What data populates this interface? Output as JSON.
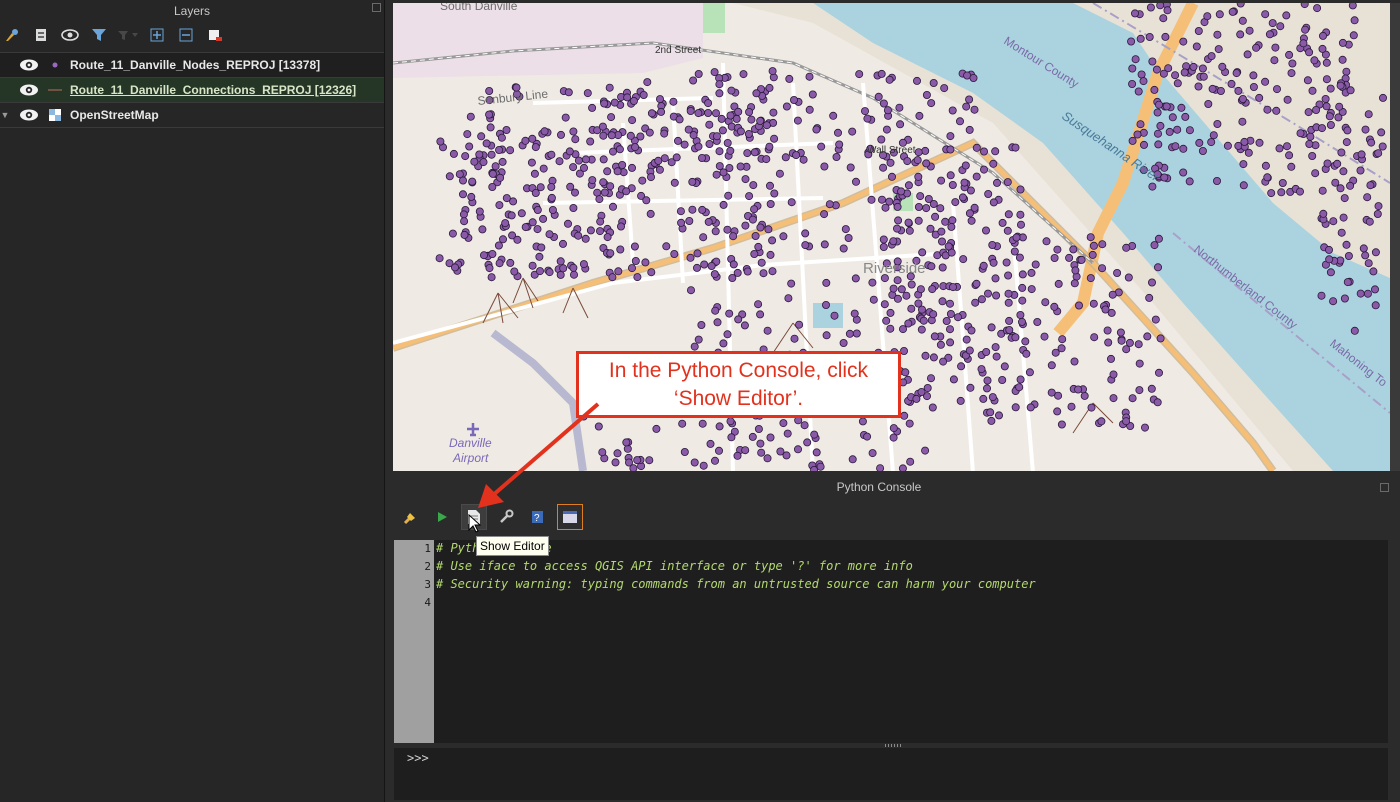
{
  "layers_panel": {
    "title": "Layers",
    "layers": [
      {
        "name": "Route_11_Danville_Nodes_REPROJ [13378]",
        "type": "point"
      },
      {
        "name": "Route_11_Danville_Connections_REPROJ [12326]",
        "type": "line"
      },
      {
        "name": "OpenStreetMap",
        "type": "raster"
      }
    ]
  },
  "map": {
    "labels": {
      "south_danville": "South Danville",
      "second_street": "2nd Street",
      "sunbury_line": "Sunbury Line",
      "montour_county": "Montour County",
      "susquehanna_river": "Susquehanna River",
      "wall_street": "Wall Street",
      "northumberland_county": "Northumberland County",
      "mahoning": "Mahoning To",
      "riverside": "Riverside",
      "airport_line1": "Danville",
      "airport_line2": "Airport"
    },
    "colors": {
      "land": "#efebe4",
      "water": "#abd3df",
      "node": "#8a5aa8",
      "highway": "#f5bf78"
    }
  },
  "callout": {
    "line1": "In the Python Console, click",
    "line2": "‘Show Editor’."
  },
  "console": {
    "title": "Python Console",
    "tooltip": "Show Editor",
    "lines": [
      {
        "num": "1",
        "text": "# Python Console"
      },
      {
        "num": "2",
        "text": "# Use iface to access QGIS API interface or type '?' for more info"
      },
      {
        "num": "3",
        "text": "# Security warning: typing commands from an untrusted source can harm your computer"
      },
      {
        "num": "4",
        "text": ""
      }
    ],
    "prompt": ">>>"
  }
}
